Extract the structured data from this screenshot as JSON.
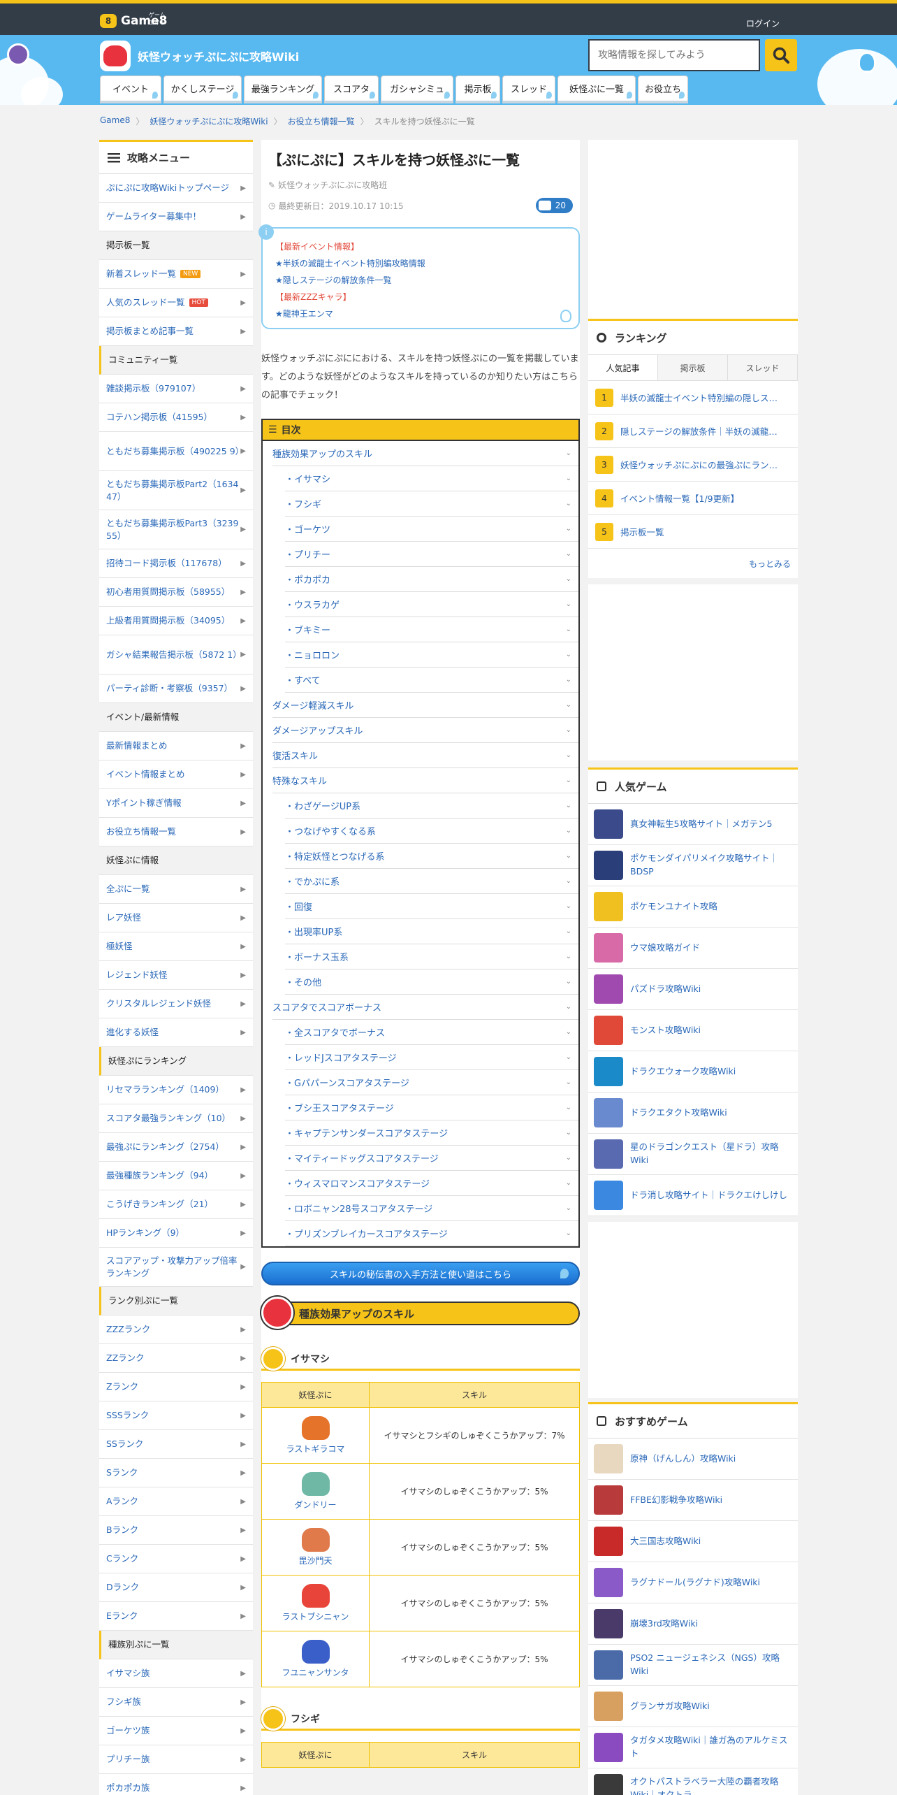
{
  "header": {
    "logo_sub": "ゲームエイト",
    "logo": "Game8",
    "login": "ログイン"
  },
  "site": {
    "title": "妖怪ウォッチぷにぷに攻略Wiki",
    "search_placeholder": "攻略情報を探してみよう"
  },
  "nav": [
    "イベント",
    "かくしステージ",
    "最強ランキング",
    "スコアタ",
    "ガシャシミュ",
    "掲示板",
    "スレッド",
    "妖怪ぷに一覧",
    "お役立ち"
  ],
  "breadcrumb": [
    "Game8",
    "妖怪ウォッチぷにぷに攻略Wiki",
    "お役立ち情報一覧",
    "スキルを持つ妖怪ぷに一覧"
  ],
  "left": {
    "title": "攻略メニュー",
    "items": [
      {
        "t": "ぷにぷに攻略Wikiトップページ"
      },
      {
        "t": "ゲームライター募集中！"
      },
      {
        "t": "掲示板一覧",
        "h": "plain"
      },
      {
        "t": "新着スレッド一覧",
        "b": "NEW",
        "bc": "#f39c12"
      },
      {
        "t": "人気のスレッド一覧",
        "b": "HOT",
        "bc": "#e74c3c"
      },
      {
        "t": "掲示板まとめ記事一覧"
      },
      {
        "t": "コミュニティ一覧",
        "h": "y"
      },
      {
        "t": "雑談掲示板（979107）"
      },
      {
        "t": "コテハン掲示板（41595）"
      },
      {
        "t": "ともだち募集掲示板（490225 9）",
        "tall": true
      },
      {
        "t": "ともだち募集掲示板Part2（1634 47）",
        "tall": true
      },
      {
        "t": "ともだち募集掲示板Part3（3239 55）",
        "tall": true
      },
      {
        "t": "招待コード掲示板（117678）"
      },
      {
        "t": "初心者用質問掲示板（58955）"
      },
      {
        "t": "上級者用質問掲示板（34095）"
      },
      {
        "t": "ガシャ結果報告掲示板（5872 1）",
        "tall": true
      },
      {
        "t": "パーティ診断・考察板（9357）"
      },
      {
        "t": "イベント/最新情報",
        "h": "plain"
      },
      {
        "t": "最新情報まとめ"
      },
      {
        "t": "イベント情報まとめ"
      },
      {
        "t": "Yポイント稼ぎ情報"
      },
      {
        "t": "お役立ち情報一覧"
      },
      {
        "t": "妖怪ぷに情報",
        "h": "plain"
      },
      {
        "t": "全ぷに一覧"
      },
      {
        "t": "レア妖怪"
      },
      {
        "t": "極妖怪"
      },
      {
        "t": "レジェンド妖怪"
      },
      {
        "t": "クリスタルレジェンド妖怪"
      },
      {
        "t": "進化する妖怪"
      },
      {
        "t": "妖怪ぷにランキング",
        "h": "y"
      },
      {
        "t": "リセマラランキング（1409）"
      },
      {
        "t": "スコアタ最強ランキング（10）"
      },
      {
        "t": "最強ぷにランキング（2754）"
      },
      {
        "t": "最強種族ランキング（94）"
      },
      {
        "t": "こうげきランキング（21）"
      },
      {
        "t": "HPランキング（9）"
      },
      {
        "t": "スコアアップ・攻撃力アップ倍率ランキング",
        "tall": true
      },
      {
        "t": "ランク別ぷに一覧",
        "h": "y"
      },
      {
        "t": "ZZZランク"
      },
      {
        "t": "ZZランク"
      },
      {
        "t": "Zランク"
      },
      {
        "t": "SSSランク"
      },
      {
        "t": "SSランク"
      },
      {
        "t": "Sランク"
      },
      {
        "t": "Aランク"
      },
      {
        "t": "Bランク"
      },
      {
        "t": "Cランク"
      },
      {
        "t": "Dランク"
      },
      {
        "t": "Eランク"
      },
      {
        "t": "種族別ぷに一覧",
        "h": "y"
      },
      {
        "t": "イサマシ族"
      },
      {
        "t": "フシギ族"
      },
      {
        "t": "ゴーケツ族"
      },
      {
        "t": "プリチー族"
      },
      {
        "t": "ポカポカ族"
      }
    ]
  },
  "article": {
    "title": "【ぷにぷに】スキルを持つ妖怪ぷに一覧",
    "author": "妖怪ウォッチぷにぷに攻略班",
    "updated": "最終更新日：2019.10.17 10:15",
    "comments": "20",
    "notice": [
      {
        "t": "【最新イベント情報】",
        "c": "#e24a3b"
      },
      {
        "t": "★半妖の滅龍士イベント特別編攻略情報",
        "c": "#2a68b8"
      },
      {
        "t": "★隠しステージの解放条件一覧",
        "c": "#2a68b8"
      },
      {
        "t": "【最新ZZZキャラ】",
        "c": "#e24a3b"
      },
      {
        "t": "★龍神王エンマ",
        "c": "#2a68b8"
      }
    ],
    "intro": "妖怪ウォッチぷにぷににおける、スキルを持つ妖怪ぷにの一覧を掲載しています。どのような妖怪がどのようなスキルを持っているのか知りたい方はこちらの記事でチェック！",
    "toc_title": "目次",
    "toc": [
      {
        "t": "種族効果アップのスキル"
      },
      {
        "t": "・イサマシ",
        "s": 1
      },
      {
        "t": "・フシギ",
        "s": 1
      },
      {
        "t": "・ゴーケツ",
        "s": 1
      },
      {
        "t": "・プリチー",
        "s": 1
      },
      {
        "t": "・ポカポカ",
        "s": 1
      },
      {
        "t": "・ウスラカゲ",
        "s": 1
      },
      {
        "t": "・ブキミー",
        "s": 1
      },
      {
        "t": "・ニョロロン",
        "s": 1
      },
      {
        "t": "・すべて",
        "s": 1
      },
      {
        "t": "ダメージ軽減スキル"
      },
      {
        "t": "ダメージアップスキル"
      },
      {
        "t": "復活スキル"
      },
      {
        "t": "特殊なスキル"
      },
      {
        "t": "・わざゲージUP系",
        "s": 1
      },
      {
        "t": "・つなげやすくなる系",
        "s": 1
      },
      {
        "t": "・特定妖怪とつなげる系",
        "s": 1
      },
      {
        "t": "・でかぷに系",
        "s": 1
      },
      {
        "t": "・回復",
        "s": 1
      },
      {
        "t": "・出現率UP系",
        "s": 1
      },
      {
        "t": "・ボーナス玉系",
        "s": 1
      },
      {
        "t": "・その他",
        "s": 1
      },
      {
        "t": "スコアタでスコアボーナス"
      },
      {
        "t": "・全スコアタでボーナス",
        "s": 1
      },
      {
        "t": "・レッドJスコアタステージ",
        "s": 1
      },
      {
        "t": "・Gパパーンスコアタステージ",
        "s": 1
      },
      {
        "t": "・ブシ王スコアタステージ",
        "s": 1
      },
      {
        "t": "・キャプテンサンダースコアタステージ",
        "s": 1
      },
      {
        "t": "・マイティードッグスコアタステージ",
        "s": 1
      },
      {
        "t": "・ウィスマロマンスコアタステージ",
        "s": 1
      },
      {
        "t": "・ロボニャン28号スコアタステージ",
        "s": 1
      },
      {
        "t": "・プリズンブレイカースコアタステージ",
        "s": 1
      }
    ],
    "cta": "スキルの秘伝書の入手方法と使い道はこちら",
    "section1": "種族効果アップのスキル",
    "sub1": "イサマシ",
    "table_headers": [
      "妖怪ぷに",
      "スキル"
    ],
    "table_rows": [
      {
        "name": "ラストギラコマ",
        "skill": "イサマシとフシギのしゅぞくこうかアップ：7%",
        "c": "#e6732a"
      },
      {
        "name": "ダンドリー",
        "skill": "イサマシのしゅぞくこうかアップ：5%",
        "c": "#6fb8a6"
      },
      {
        "name": "毘沙門天",
        "skill": "イサマシのしゅぞくこうかアップ：5%",
        "c": "#e07a4a"
      },
      {
        "name": "ラストブシニャン",
        "skill": "イサマシのしゅぞくこうかアップ：5%",
        "c": "#e8443a"
      },
      {
        "name": "フユニャンサンタ",
        "skill": "イサマシのしゅぞくこうかアップ：5%",
        "c": "#3a5fc8"
      }
    ],
    "sub2": "フシギ"
  },
  "right": {
    "ranking_title": "ランキング",
    "tabs": [
      "人気記事",
      "掲示板",
      "スレッド"
    ],
    "ranks": [
      "半妖の滅龍士イベント特別編の隠しス…",
      "隠しステージの解放条件｜半妖の滅龍…",
      "妖怪ウォッチぷにぷにの最強ぷにラン…",
      "イベント情報一覧【1/9更新】",
      "掲示板一覧"
    ],
    "more": "もっとみる",
    "popular_title": "人気ゲーム",
    "popular": [
      {
        "t": "真女神転生5攻略サイト｜メガテン5",
        "c": "#3b4a8a"
      },
      {
        "t": "ポケモンダイパリメイク攻略サイト｜BDSP",
        "c": "#2a3f7a"
      },
      {
        "t": "ポケモンユナイト攻略",
        "c": "#f0c020"
      },
      {
        "t": "ウマ娘攻略ガイド",
        "c": "#d86aa8"
      },
      {
        "t": "パズドラ攻略Wiki",
        "c": "#a04ab0"
      },
      {
        "t": "モンスト攻略Wiki",
        "c": "#e04838"
      },
      {
        "t": "ドラクエウォーク攻略Wiki",
        "c": "#1a8ac8"
      },
      {
        "t": "ドラクエタクト攻略Wiki",
        "c": "#6a8ad0"
      },
      {
        "t": "星のドラゴンクエスト（星ドラ）攻略Wiki",
        "c": "#5a6ab0"
      },
      {
        "t": "ドラ消し攻略サイト｜ドラクエけしけし",
        "c": "#3a88e0"
      }
    ],
    "rec_title": "おすすめゲーム",
    "rec": [
      {
        "t": "原神（げんしん）攻略Wiki",
        "c": "#e8d8c0"
      },
      {
        "t": "FFBE幻影戦争攻略Wiki",
        "c": "#b83a3a"
      },
      {
        "t": "大三国志攻略Wiki",
        "c": "#c82a2a"
      },
      {
        "t": "ラグナドール(ラグナド)攻略Wiki",
        "c": "#8a5ac8"
      },
      {
        "t": "崩壊3rd攻略Wiki",
        "c": "#4a3a6a"
      },
      {
        "t": "PSO2 ニュージェネシス（NGS）攻略Wiki",
        "c": "#4a6aa8"
      },
      {
        "t": "グランサガ攻略Wiki",
        "c": "#d8a060"
      },
      {
        "t": "タガタメ攻略Wiki｜誰ガ為のアルケミスト",
        "c": "#8a4ac0"
      },
      {
        "t": "オクトパストラベラー大陸の覇者攻略Wiki｜オクトラ",
        "c": "#3a3a3a"
      }
    ]
  }
}
